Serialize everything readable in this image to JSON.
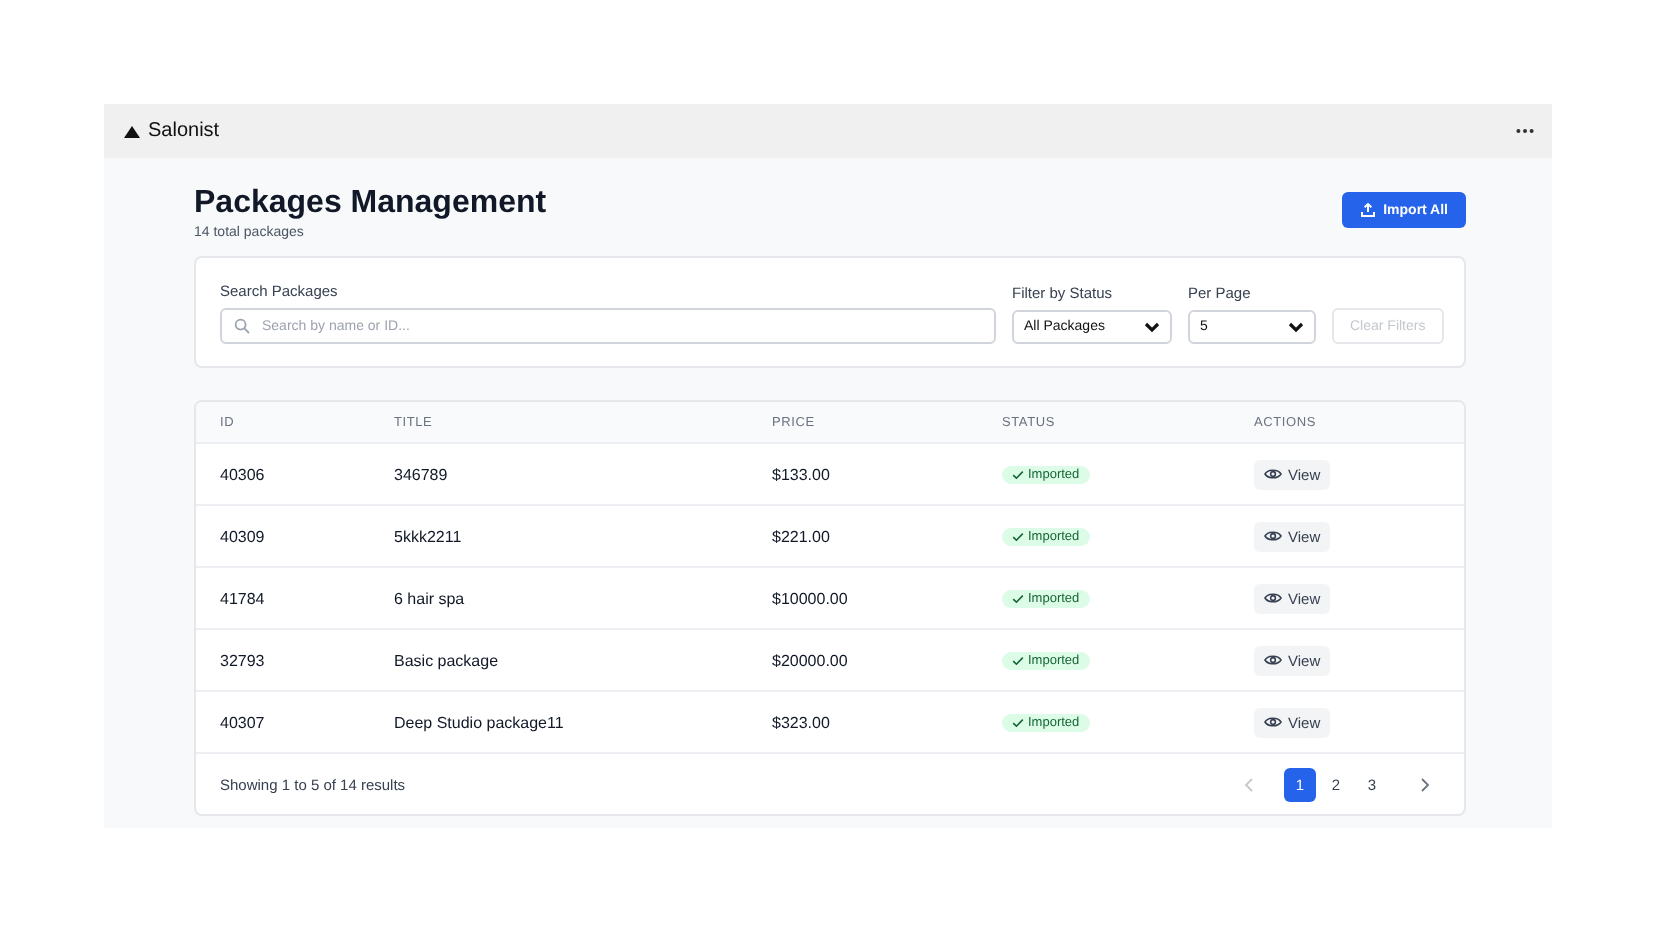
{
  "app": {
    "title": "Salonist"
  },
  "page": {
    "title": "Packages Management",
    "subtitle": "14 total packages",
    "import_button": "Import All"
  },
  "filters": {
    "search": {
      "label": "Search Packages",
      "placeholder": "Search by name or ID..."
    },
    "status": {
      "label": "Filter by Status",
      "value": "All Packages"
    },
    "per_page": {
      "label": "Per Page",
      "value": "5"
    },
    "clear_button": {
      "label": "Clear Filters",
      "disabled": true
    }
  },
  "table": {
    "columns": [
      "ID",
      "TITLE",
      "PRICE",
      "STATUS",
      "ACTIONS"
    ],
    "rows": [
      {
        "id": "40306",
        "title": "346789",
        "price": "$133.00",
        "status": "Imported",
        "action": "View"
      },
      {
        "id": "40309",
        "title": "5kkk2211",
        "price": "$221.00",
        "status": "Imported",
        "action": "View"
      },
      {
        "id": "41784",
        "title": "6 hair spa",
        "price": "$10000.00",
        "status": "Imported",
        "action": "View"
      },
      {
        "id": "32793",
        "title": "Basic package",
        "price": "$20000.00",
        "status": "Imported",
        "action": "View"
      },
      {
        "id": "40307",
        "title": "Deep Studio package11",
        "price": "$323.00",
        "status": "Imported",
        "action": "View"
      }
    ]
  },
  "pagination": {
    "summary": "Showing 1 to 5 of 14 results",
    "prev_disabled": true,
    "next_disabled": false,
    "pages": [
      {
        "label": "1",
        "selected": true
      },
      {
        "label": "2",
        "selected": false
      },
      {
        "label": "3",
        "selected": false
      }
    ]
  }
}
